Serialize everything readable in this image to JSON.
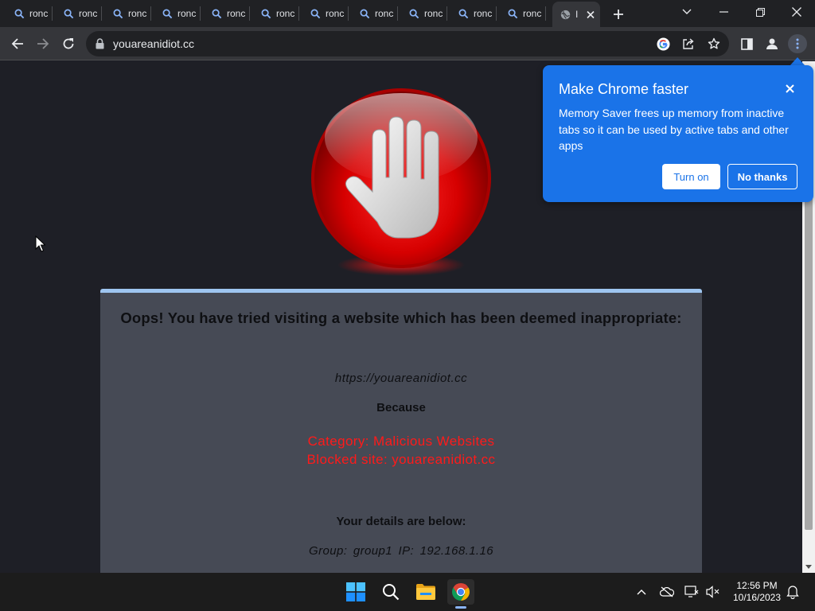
{
  "browser": {
    "tabs": [
      {
        "title": "ronc"
      },
      {
        "title": "ronc"
      },
      {
        "title": "ronc"
      },
      {
        "title": "ronc"
      },
      {
        "title": "ronc"
      },
      {
        "title": "ronc"
      },
      {
        "title": "ronc"
      },
      {
        "title": "ronc"
      },
      {
        "title": "ronc"
      },
      {
        "title": "ronc"
      },
      {
        "title": "ronc"
      }
    ],
    "active_tab": {
      "title": "I"
    },
    "url": "youareanidiot.cc"
  },
  "page": {
    "headline": "Oops! You have tried visiting a website which has been deemed inappropriate:",
    "blocked_url": "https://youareanidiot.cc",
    "because": "Because",
    "category": "Category: Malicious Websites",
    "blocked_site": "Blocked site: youareanidiot.cc",
    "details_heading": "Your details are below:",
    "group_ip": "Group: group1   IP: 192.168.1.16"
  },
  "memory_saver": {
    "title": "Make Chrome faster",
    "body": "Memory Saver frees up memory from inactive tabs so it can be used by active tabs and other apps",
    "turn_on": "Turn on",
    "no_thanks": "No thanks"
  },
  "taskbar": {
    "time": "12:56 PM",
    "date": "10/16/2023"
  },
  "colors": {
    "accent_blue": "#1a73e8",
    "warning_red": "#ff1a1a",
    "card_bg": "#464a55",
    "card_border": "#9ec5f0"
  }
}
